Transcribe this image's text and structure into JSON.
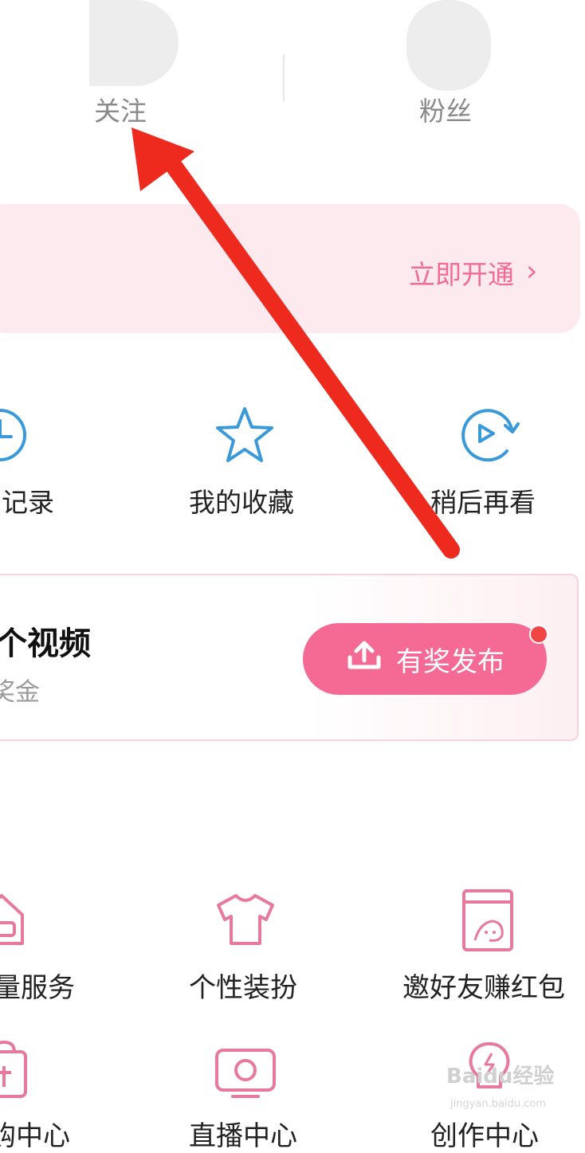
{
  "stats": {
    "following_label": "关注",
    "fans_label": "粉丝"
  },
  "vip_banner": {
    "action_label": "立即开通",
    "chevron": "›"
  },
  "quick_actions": [
    {
      "label": "记录",
      "icon": "clock-icon"
    },
    {
      "label": "我的收藏",
      "icon": "star-icon"
    },
    {
      "label": "稍后再看",
      "icon": "watch-later-icon"
    }
  ],
  "upload_card": {
    "title": "个视频",
    "subtitle": "奖金",
    "button_label": "有奖发布",
    "button_icon": "upload-icon"
  },
  "services": [
    {
      "label": "量服务",
      "icon": "house-icon"
    },
    {
      "label": "个性装扮",
      "icon": "shirt-icon"
    },
    {
      "label": "邀好友赚红包",
      "icon": "invite-icon"
    },
    {
      "label": "购中心",
      "icon": "shop-icon"
    },
    {
      "label": "直播中心",
      "icon": "tv-icon"
    },
    {
      "label": "创作中心",
      "icon": "bulb-icon"
    }
  ],
  "watermark": {
    "brand": "Baidu经验",
    "url": "jingyan.baidu.com"
  },
  "colors": {
    "accent_pink": "#f46a95",
    "icon_blue": "#3a9ad9",
    "arrow_red": "#ee2a1f",
    "banner_bg": "#fdeaef"
  }
}
